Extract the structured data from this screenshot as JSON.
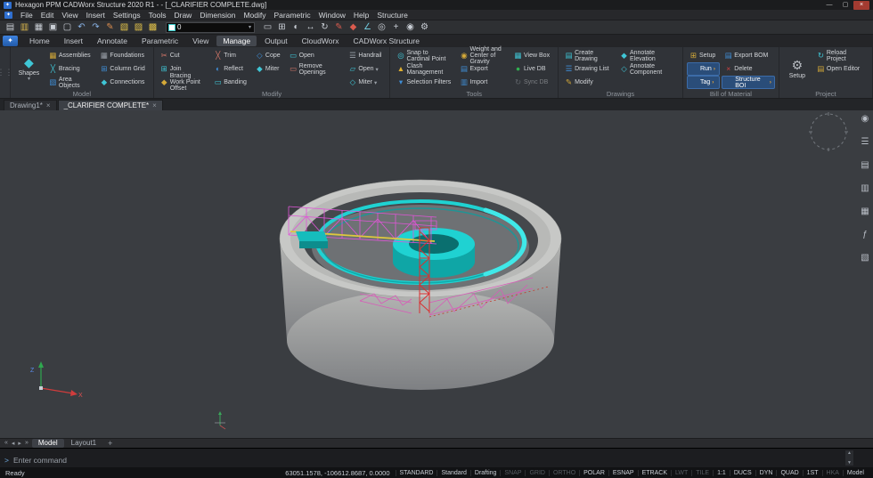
{
  "window": {
    "icon": "✦",
    "title": "Hexagon PPM CADWorx Structure 2020 R1 - - [_CLARIFIER COMPLETE.dwg]",
    "minimize": "—",
    "maximize": "▢",
    "close": "×"
  },
  "menubar": {
    "icon": "✦",
    "items": [
      "File",
      "Edit",
      "View",
      "Insert",
      "Settings",
      "Tools",
      "Draw",
      "Dimension",
      "Modify",
      "Parametric",
      "Window",
      "Help",
      "Structure"
    ]
  },
  "qat": {
    "icons_a": [
      {
        "name": "new-file-icon",
        "glyph": "▤",
        "color": "#c9ced5"
      },
      {
        "name": "open-file-icon",
        "glyph": "▥",
        "color": "#d9b64e"
      },
      {
        "name": "save-icon",
        "glyph": "▦",
        "color": "#c9ced5"
      },
      {
        "name": "plot-icon",
        "glyph": "▣",
        "color": "#c9ced5"
      },
      {
        "name": "plot-preview-icon",
        "glyph": "▢",
        "color": "#c9ced5"
      },
      {
        "name": "undo-icon",
        "glyph": "↶",
        "color": "#8ab4e8"
      },
      {
        "name": "redo-icon",
        "glyph": "↷",
        "color": "#8ab4e8"
      },
      {
        "name": "match-properties-icon",
        "glyph": "✎",
        "color": "#d98c4e"
      },
      {
        "name": "layer-states-icon",
        "glyph": "▧",
        "color": "#e3c34a"
      },
      {
        "name": "layer-isolate-icon",
        "glyph": "▨",
        "color": "#e3c34a"
      },
      {
        "name": "layer-off-icon",
        "glyph": "▩",
        "color": "#e3c34a"
      }
    ],
    "layer_combo": {
      "value": "0",
      "arrow": "▾"
    },
    "icons_b": [
      {
        "name": "erase-icon",
        "glyph": "▭",
        "color": "#c9ced5"
      },
      {
        "name": "copy-icon",
        "glyph": "⊞",
        "color": "#c9ced5"
      },
      {
        "name": "mirror-icon",
        "glyph": "◐",
        "color": "#c9ced5"
      },
      {
        "name": "move-icon",
        "glyph": "↔",
        "color": "#c9ced5"
      },
      {
        "name": "rotate-icon",
        "glyph": "↻",
        "color": "#c9ced5"
      },
      {
        "name": "draw-pencil-icon",
        "glyph": "✎",
        "color": "#d95b4e"
      },
      {
        "name": "hatch-icon",
        "glyph": "◆",
        "color": "#d95b4e"
      },
      {
        "name": "measure-icon",
        "glyph": "∠",
        "color": "#6fc6d9"
      },
      {
        "name": "zoom-icon",
        "glyph": "◎",
        "color": "#c9ced5"
      },
      {
        "name": "pan-icon",
        "glyph": "+",
        "color": "#c9ced5"
      },
      {
        "name": "orbit-icon",
        "glyph": "◉",
        "color": "#c9ced5"
      },
      {
        "name": "settings-icon",
        "glyph": "⚙",
        "color": "#c9ced5"
      }
    ]
  },
  "ribbon": {
    "app_button": "✦",
    "tabs": [
      {
        "label": "Home"
      },
      {
        "label": "Insert"
      },
      {
        "label": "Annotate"
      },
      {
        "label": "Parametric"
      },
      {
        "label": "View"
      },
      {
        "label": "Manage",
        "active": true
      },
      {
        "label": "Output"
      },
      {
        "label": "CloudWorx"
      },
      {
        "label": "CADWorx Structure"
      }
    ],
    "panels": {
      "model": {
        "title": "Model",
        "big": {
          "icon": "◆",
          "label": "Shapes",
          "arrow": "▾"
        },
        "items": [
          {
            "icon": "▦",
            "color": "#d4a938",
            "label": "Assemblies"
          },
          {
            "icon": "╳",
            "color": "#3fc6d6",
            "label": "Bracing"
          },
          {
            "icon": "▧",
            "color": "#3f8ed6",
            "label": "Area Objects"
          },
          {
            "icon": "▦",
            "color": "#9aa0a8",
            "label": "Foundations"
          },
          {
            "icon": "⊞",
            "color": "#3f8ed6",
            "label": "Column Grid"
          },
          {
            "icon": "◆",
            "color": "#3fc6d6",
            "label": "Connections"
          }
        ]
      },
      "modify": {
        "title": "Modify",
        "items": [
          {
            "icon": "✂",
            "color": "#d6786a",
            "label": "Cut"
          },
          {
            "icon": "⊞",
            "color": "#3fc6d6",
            "label": "Join"
          },
          {
            "icon": "◆",
            "color": "#d4a938",
            "label": "Bracing Work Point Offset"
          },
          {
            "icon": "╳",
            "color": "#d6786a",
            "label": "Trim"
          },
          {
            "icon": "◐",
            "color": "#3f8ed6",
            "label": "Reflect"
          },
          {
            "icon": "▭",
            "color": "#3fc6d6",
            "label": "Banding"
          },
          {
            "icon": "◇",
            "color": "#3f8ed6",
            "label": "Cope"
          },
          {
            "icon": "◆",
            "color": "#3fc6d6",
            "label": "Miter"
          },
          {
            "icon": "",
            "label": ""
          },
          {
            "icon": "▭",
            "color": "#3fc6d6",
            "label": "Open"
          },
          {
            "icon": "▭",
            "color": "#d6786a",
            "label": "Remove Openings"
          },
          {
            "icon": "",
            "label": ""
          },
          {
            "icon": "☰",
            "color": "#9aa0a8",
            "label": "Handrail"
          },
          {
            "icon": "▱",
            "color": "#3fc6d6",
            "label": "Open",
            "suffix": "▾"
          },
          {
            "icon": "◇",
            "color": "#3fc6d6",
            "label": "Miter",
            "suffix": "▾"
          }
        ]
      },
      "tools": {
        "title": "Tools",
        "items": [
          {
            "icon": "◎",
            "color": "#3fc6d6",
            "label": "Snap to Cardinal Point"
          },
          {
            "icon": "▲",
            "color": "#e0b030",
            "label": "Clash Management"
          },
          {
            "icon": "▾",
            "color": "#3f8ed6",
            "label": "Selection Filters"
          },
          {
            "icon": "◉",
            "color": "#d4a938",
            "label": "Weight and Center of Gravity"
          },
          {
            "icon": "▤",
            "color": "#3f8ed6",
            "label": "Export"
          },
          {
            "icon": "▥",
            "color": "#3f8ed6",
            "label": "Import"
          },
          {
            "icon": "▦",
            "color": "#3fc6d6",
            "label": "View Box"
          },
          {
            "icon": "●",
            "color": "#30b050",
            "label": "Live DB"
          },
          {
            "icon": "↻",
            "color": "#9aa0a8",
            "label": "Sync DB",
            "disabled": true
          }
        ]
      },
      "drawings": {
        "title": "Drawings",
        "items": [
          {
            "icon": "▤",
            "color": "#3fc6d6",
            "label": "Create Drawing"
          },
          {
            "icon": "☰",
            "color": "#3f8ed6",
            "label": "Drawing List"
          },
          {
            "icon": "✎",
            "color": "#d4a938",
            "label": "Modify"
          },
          {
            "icon": "◆",
            "color": "#3fc6d6",
            "label": "Annotate Elevation"
          },
          {
            "icon": "◇",
            "color": "#3fc6d6",
            "label": "Annotate Component"
          }
        ]
      },
      "bom": {
        "title": "Bill of Material",
        "items": [
          {
            "icon": "⊞",
            "color": "#d4a938",
            "label": "Setup"
          },
          {
            "icon": "",
            "label": "Run",
            "suffix": "›",
            "highlight": true
          },
          {
            "icon": "",
            "label": "Tag",
            "suffix": "›",
            "highlight": true
          },
          {
            "icon": "▤",
            "color": "#3f8ed6",
            "label": "Export BOM"
          },
          {
            "icon": "×",
            "color": "#d04040",
            "label": "Delete"
          },
          {
            "icon": "",
            "label": "Structure BOI",
            "suffix": "›",
            "highlight": true
          }
        ]
      },
      "project": {
        "title": "Project",
        "big": {
          "icon": "⚙",
          "label": "Setup"
        },
        "items": [
          {
            "icon": "↻",
            "color": "#3fc6d6",
            "label": "Reload Project"
          },
          {
            "icon": "▤",
            "color": "#d4a938",
            "label": "Open Editor"
          }
        ]
      }
    }
  },
  "doc_tabs": {
    "items": [
      {
        "label": "Drawing1*",
        "close": "×"
      },
      {
        "label": "_CLARIFIER COMPLETE*",
        "close": "×",
        "active": true
      }
    ],
    "new_tab": "+"
  },
  "viewport": {
    "colors": {
      "background": "#3a3d41",
      "rim": "#c7c8c6",
      "cavity": "#45484c",
      "floor": "#6e7174",
      "cyan": "#1fd2d2",
      "magenta": "#e055d8",
      "pink": "#d85ab8",
      "red": "#d93030",
      "yellow": "#ddc83d"
    },
    "nav_icons": [
      {
        "name": "nav-pin-icon",
        "glyph": "◉"
      },
      {
        "name": "nav-menu-icon",
        "glyph": "☰"
      },
      {
        "name": "nav-layers-icon",
        "glyph": "▤"
      },
      {
        "name": "nav-clip-icon",
        "glyph": "▥"
      },
      {
        "name": "nav-table-icon",
        "glyph": "▦"
      },
      {
        "name": "nav-function-icon",
        "glyph": "ƒ"
      },
      {
        "name": "nav-parts-icon",
        "glyph": "▧"
      }
    ],
    "ucs": {
      "x_label": "X",
      "z_label": "Z"
    }
  },
  "model_tabs": {
    "nav": [
      "«",
      "◂",
      "▸",
      "»"
    ],
    "items": [
      {
        "label": "Model",
        "active": true
      },
      {
        "label": "Layout1"
      }
    ],
    "new_tab": "+"
  },
  "command": {
    "prompt": ">",
    "placeholder": "Enter command"
  },
  "statusbar": {
    "ready": "Ready",
    "coords": "63051.1578, -106612.8687, 0.0000",
    "modes": [
      {
        "label": "STANDARD",
        "on": true
      },
      {
        "label": "Standard",
        "on": true
      },
      {
        "label": "Drafting",
        "on": true
      },
      {
        "label": "SNAP"
      },
      {
        "label": "GRID"
      },
      {
        "label": "ORTHO"
      },
      {
        "label": "POLAR",
        "on": true
      },
      {
        "label": "ESNAP",
        "on": true
      },
      {
        "label": "ETRACK",
        "on": true
      },
      {
        "label": "LWT"
      },
      {
        "label": "TILE"
      },
      {
        "label": "1:1",
        "on": true
      },
      {
        "label": "DUCS",
        "on": true
      },
      {
        "label": "DYN",
        "on": true
      },
      {
        "label": "QUAD",
        "on": true
      },
      {
        "label": "1ST",
        "on": true
      },
      {
        "label": "HKA"
      },
      {
        "label": "Model",
        "on": true
      }
    ]
  }
}
